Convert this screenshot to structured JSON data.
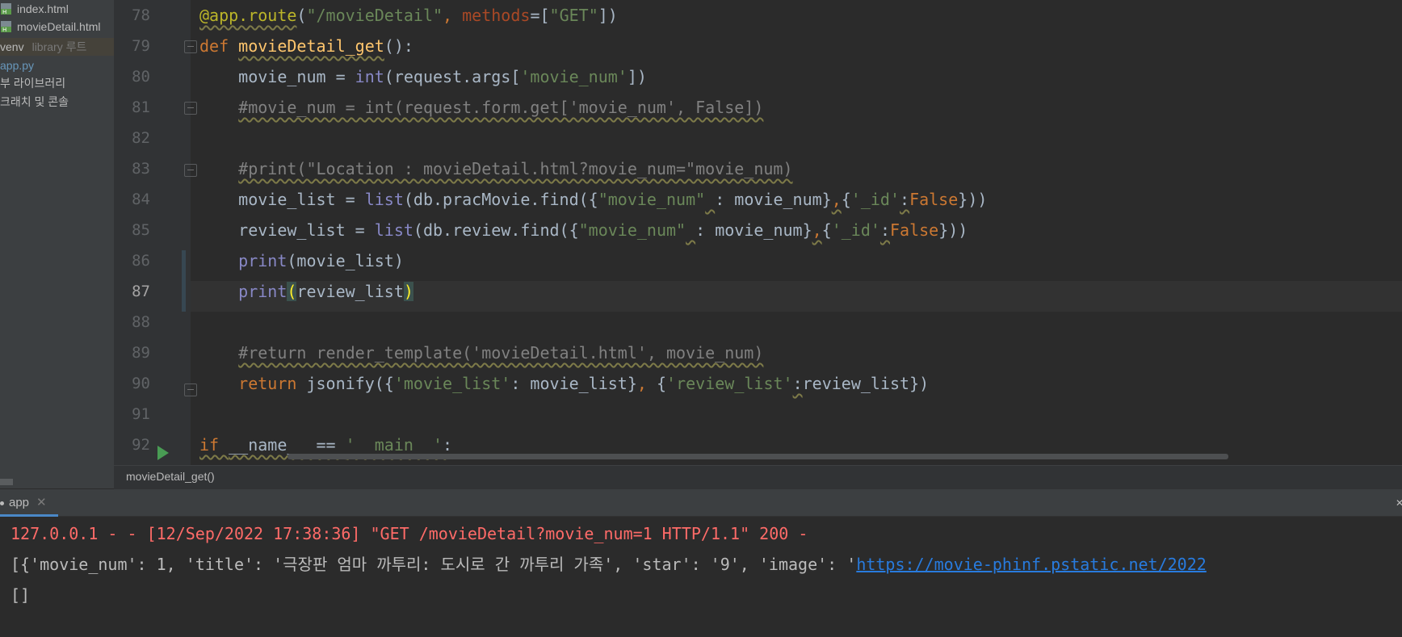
{
  "colors": {
    "background": "#2b2b2b",
    "gutter": "#313335",
    "keyword": "#cc7832",
    "string": "#6a8759",
    "comment": "#808080",
    "builtin": "#8888c6",
    "decorator": "#bbb529",
    "function_name": "#ffc66d",
    "error_output": "#ff6b68",
    "link": "#287bde",
    "run_icon": "#499c54"
  },
  "project_tree": {
    "items": [
      {
        "label": "index.html",
        "icon": "html-file-icon"
      },
      {
        "label": "movieDetail.html",
        "icon": "html-file-icon"
      },
      {
        "label": "venv",
        "sublabel": "library 루트",
        "selected": true
      },
      {
        "label": "app.py",
        "icon": "python-file-icon"
      },
      {
        "label": "부 라이브러리"
      },
      {
        "label": "크래치 및 콘솔"
      }
    ]
  },
  "editor": {
    "lines": [
      {
        "num": "78",
        "code": "@app.route(\"/movieDetail\", methods=[\"GET\"])"
      },
      {
        "num": "79",
        "code": "def movieDetail_get():"
      },
      {
        "num": "80",
        "code": "    movie_num = int(request.args['movie_num'])"
      },
      {
        "num": "81",
        "code": "    #movie_num = int(request.form.get['movie_num', False])"
      },
      {
        "num": "82",
        "code": ""
      },
      {
        "num": "83",
        "code": "    #print(\"Location : movieDetail.html?movie_num=\"movie_num)"
      },
      {
        "num": "84",
        "code": "    movie_list = list(db.pracMovie.find({\"movie_num\" : movie_num},{'_id':False}))"
      },
      {
        "num": "85",
        "code": "    review_list = list(db.review.find({\"movie_num\" : movie_num},{'_id':False}))"
      },
      {
        "num": "86",
        "code": "    print(movie_list)"
      },
      {
        "num": "87",
        "code": "    print(review_list)"
      },
      {
        "num": "88",
        "code": ""
      },
      {
        "num": "89",
        "code": "    #return render_template('movieDetail.html', movie_num)"
      },
      {
        "num": "90",
        "code": "    return jsonify({'movie_list': movie_list}, {'review_list':review_list})"
      },
      {
        "num": "91",
        "code": ""
      },
      {
        "num": "92",
        "code": "if __name__ == '__main__':"
      }
    ],
    "current_line": "87",
    "breadcrumb": "movieDetail_get()"
  },
  "run_panel": {
    "tab_label": "app",
    "close_glyph": "✕",
    "corner_glyph": "✕",
    "output": [
      {
        "text": "127.0.0.1 - - [12/Sep/2022 17:38:36] \"GET /movieDetail?movie_num=1 HTTP/1.1\" 200 -",
        "kind": "stderr"
      },
      {
        "prefix": "[{'movie_num': 1, 'title': '극장판 엄마 까투리: 도시로 간 까투리 가족', 'star': '9', 'image': '",
        "link": "https://movie-phinf.pstatic.net/2022",
        "kind": "stdout"
      },
      {
        "text": "[]",
        "kind": "stdout"
      }
    ]
  }
}
